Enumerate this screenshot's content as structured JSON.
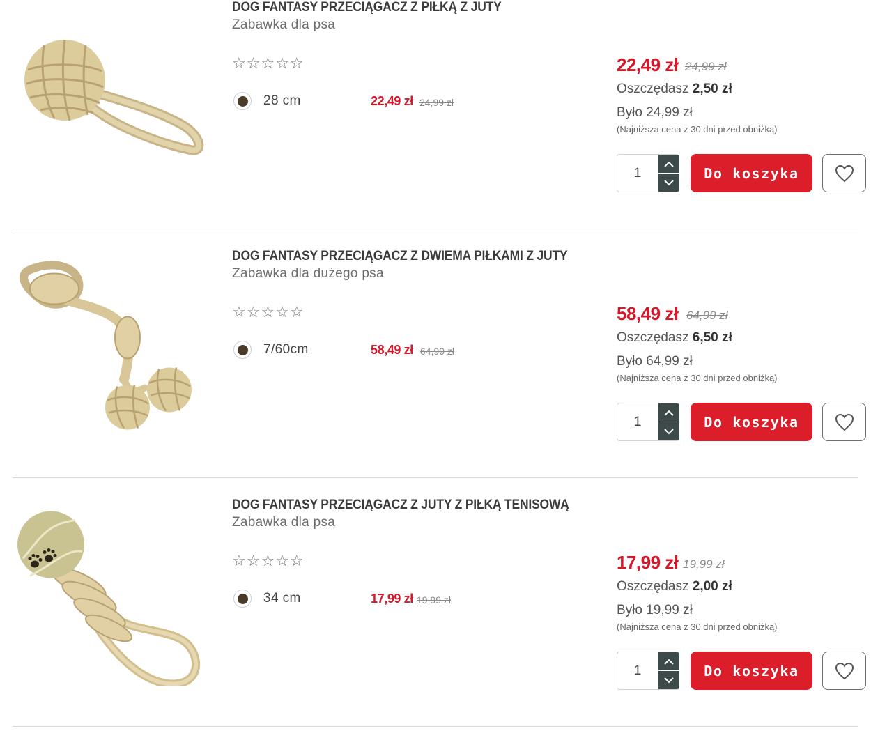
{
  "products": [
    {
      "title": "DOG FANTASY PRZECIĄGACZ Z PIŁKĄ Z JUTY",
      "subtitle": "Zabawka dla psa",
      "stars": "☆☆☆☆☆",
      "variant": {
        "label": "28 cm",
        "price": "22,49 zł",
        "old_price": "24,99 zł"
      },
      "price": "22,49 zł",
      "old_price": "24,99 zł",
      "saving_label": "Oszczędasz",
      "saving_value": "2,50 zł",
      "was": "Było 24,99 zł",
      "lowest_price_note": "(Najniższa cena z 30 dni przed obniżką)",
      "quantity": "1",
      "cart_label": "Do koszyka",
      "image_icon": "rope-ball-loop-toy"
    },
    {
      "title": "DOG FANTASY PRZECIĄGACZ Z DWIEMA PIŁKAMI Z JUTY",
      "subtitle": "Zabawka dla dużego psa",
      "stars": "☆☆☆☆☆",
      "variant": {
        "label": "7/60cm",
        "price": "58,49 zł",
        "old_price": "64,99 zł"
      },
      "price": "58,49 zł",
      "old_price": "64,99 zł",
      "saving_label": "Oszczędasz",
      "saving_value": "6,50 zł",
      "was": "Było 64,99 zł",
      "lowest_price_note": "(Najniższa cena z 30 dni przed obniżką)",
      "quantity": "1",
      "cart_label": "Do koszyka",
      "image_icon": "rope-two-balls-toy"
    },
    {
      "title": "DOG FANTASY PRZECIĄGACZ Z JUTY Z PIŁKĄ TENISOWĄ",
      "subtitle": "Zabawka dla psa",
      "stars": "☆☆☆☆☆",
      "variant": {
        "label": "34 cm",
        "price": "17,99 zł",
        "old_price": "19,99 zł"
      },
      "price": "17,99 zł",
      "old_price": "19,99 zł",
      "saving_label": "Oszczędasz",
      "saving_value": "2,00 zł",
      "was": "Było 19,99 zł",
      "lowest_price_note": "(Najniższa cena z 30 dni przed obniżką)",
      "quantity": "1",
      "cart_label": "Do koszyka",
      "image_icon": "rope-tennis-ball-toy"
    }
  ],
  "colors": {
    "accent_red": "#dc1d2a",
    "sale_price": "#d6172a",
    "stepper_dark": "#3d4a4a",
    "variant_swatch": "#4a3a28"
  }
}
